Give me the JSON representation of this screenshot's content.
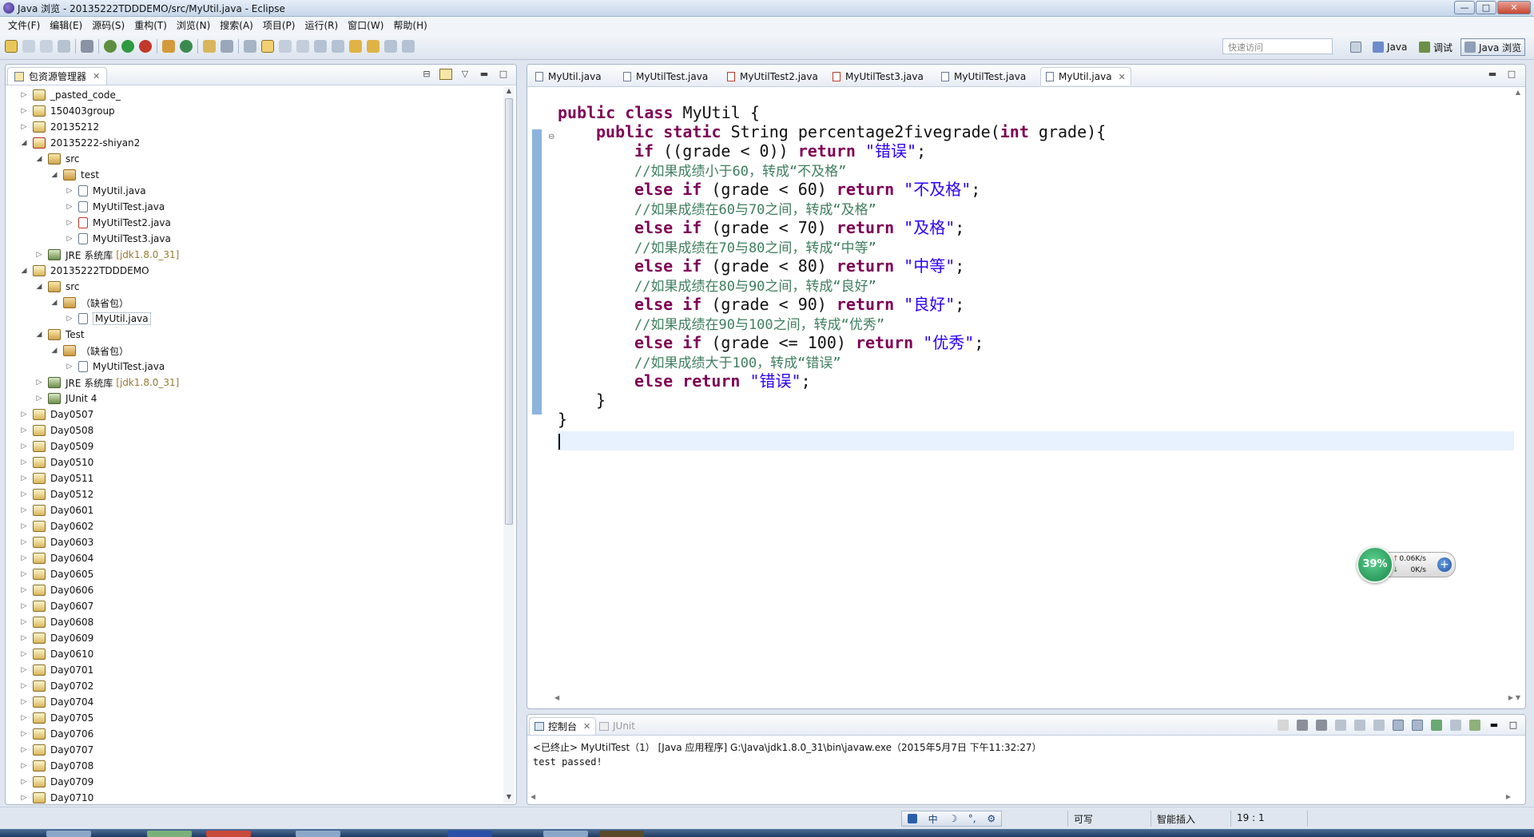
{
  "window": {
    "title": "Java 浏览 - 20135222TDDDEMO/src/MyUtil.java - Eclipse",
    "controls": [
      "—",
      "□",
      "✕"
    ]
  },
  "menu": [
    "文件(F)",
    "编辑(E)",
    "源码(S)",
    "重构(T)",
    "浏览(N)",
    "搜索(A)",
    "项目(P)",
    "运行(R)",
    "窗口(W)",
    "帮助(H)"
  ],
  "toolbar": {
    "quick_access_placeholder": "快速访问",
    "perspectives": [
      "Java",
      "调试",
      "Java 浏览"
    ],
    "active_perspective": "Java 浏览"
  },
  "package_explorer": {
    "title": "包资源管理器",
    "items": [
      {
        "label": "_pasted_code_",
        "depth": 0,
        "twisty": "▷",
        "icon": "project"
      },
      {
        "label": "150403group",
        "depth": 0,
        "twisty": "▷",
        "icon": "project"
      },
      {
        "label": "20135212",
        "depth": 0,
        "twisty": "▷",
        "icon": "project"
      },
      {
        "label": "20135222-shiyan2",
        "depth": 0,
        "twisty": "◢",
        "icon": "project-err"
      },
      {
        "label": "src",
        "depth": 1,
        "twisty": "◢",
        "icon": "src"
      },
      {
        "label": "test",
        "depth": 2,
        "twisty": "◢",
        "icon": "pkg"
      },
      {
        "label": "MyUtil.java",
        "depth": 3,
        "twisty": "▷",
        "icon": "java"
      },
      {
        "label": "MyUtilTest.java",
        "depth": 3,
        "twisty": "▷",
        "icon": "java"
      },
      {
        "label": "MyUtilTest2.java",
        "depth": 3,
        "twisty": "▷",
        "icon": "java-err"
      },
      {
        "label": "MyUtilTest3.java",
        "depth": 3,
        "twisty": "▷",
        "icon": "java"
      },
      {
        "label": "JRE 系统库",
        "suffix": "[jdk1.8.0_31]",
        "depth": 1,
        "twisty": "▷",
        "icon": "lib"
      },
      {
        "label": "20135222TDDDEMO",
        "depth": 0,
        "twisty": "◢",
        "icon": "project"
      },
      {
        "label": "src",
        "depth": 1,
        "twisty": "◢",
        "icon": "src"
      },
      {
        "label": "（缺省包）",
        "depth": 2,
        "twisty": "◢",
        "icon": "pkg"
      },
      {
        "label": "MyUtil.java",
        "depth": 3,
        "twisty": "▷",
        "icon": "java",
        "selected": true
      },
      {
        "label": "Test",
        "depth": 1,
        "twisty": "◢",
        "icon": "src"
      },
      {
        "label": "（缺省包）",
        "depth": 2,
        "twisty": "◢",
        "icon": "pkg"
      },
      {
        "label": "MyUtilTest.java",
        "depth": 3,
        "twisty": "▷",
        "icon": "java"
      },
      {
        "label": "JRE 系统库",
        "suffix": "[jdk1.8.0_31]",
        "depth": 1,
        "twisty": "▷",
        "icon": "lib"
      },
      {
        "label": "JUnit 4",
        "depth": 1,
        "twisty": "▷",
        "icon": "lib"
      },
      {
        "label": "Day0507",
        "depth": 0,
        "twisty": "▷",
        "icon": "project"
      },
      {
        "label": "Day0508",
        "depth": 0,
        "twisty": "▷",
        "icon": "project"
      },
      {
        "label": "Day0509",
        "depth": 0,
        "twisty": "▷",
        "icon": "project"
      },
      {
        "label": "Day0510",
        "depth": 0,
        "twisty": "▷",
        "icon": "project"
      },
      {
        "label": "Day0511",
        "depth": 0,
        "twisty": "▷",
        "icon": "project"
      },
      {
        "label": "Day0512",
        "depth": 0,
        "twisty": "▷",
        "icon": "project"
      },
      {
        "label": "Day0601",
        "depth": 0,
        "twisty": "▷",
        "icon": "project"
      },
      {
        "label": "Day0602",
        "depth": 0,
        "twisty": "▷",
        "icon": "project"
      },
      {
        "label": "Day0603",
        "depth": 0,
        "twisty": "▷",
        "icon": "project"
      },
      {
        "label": "Day0604",
        "depth": 0,
        "twisty": "▷",
        "icon": "project"
      },
      {
        "label": "Day0605",
        "depth": 0,
        "twisty": "▷",
        "icon": "project"
      },
      {
        "label": "Day0606",
        "depth": 0,
        "twisty": "▷",
        "icon": "project"
      },
      {
        "label": "Day0607",
        "depth": 0,
        "twisty": "▷",
        "icon": "project"
      },
      {
        "label": "Day0608",
        "depth": 0,
        "twisty": "▷",
        "icon": "project"
      },
      {
        "label": "Day0609",
        "depth": 0,
        "twisty": "▷",
        "icon": "project"
      },
      {
        "label": "Day0610",
        "depth": 0,
        "twisty": "▷",
        "icon": "project"
      },
      {
        "label": "Day0701",
        "depth": 0,
        "twisty": "▷",
        "icon": "project"
      },
      {
        "label": "Day0702",
        "depth": 0,
        "twisty": "▷",
        "icon": "project"
      },
      {
        "label": "Day0704",
        "depth": 0,
        "twisty": "▷",
        "icon": "project"
      },
      {
        "label": "Day0705",
        "depth": 0,
        "twisty": "▷",
        "icon": "project"
      },
      {
        "label": "Day0706",
        "depth": 0,
        "twisty": "▷",
        "icon": "project"
      },
      {
        "label": "Day0707",
        "depth": 0,
        "twisty": "▷",
        "icon": "project"
      },
      {
        "label": "Day0708",
        "depth": 0,
        "twisty": "▷",
        "icon": "project"
      },
      {
        "label": "Day0709",
        "depth": 0,
        "twisty": "▷",
        "icon": "project"
      },
      {
        "label": "Day0710",
        "depth": 0,
        "twisty": "▷",
        "icon": "project"
      }
    ]
  },
  "editor": {
    "tabs": [
      {
        "label": "MyUtil.java",
        "active": false,
        "error": false
      },
      {
        "label": "MyUtilTest.java",
        "active": false,
        "error": false
      },
      {
        "label": "MyUtilTest2.java",
        "active": false,
        "error": true
      },
      {
        "label": "MyUtilTest3.java",
        "active": false,
        "error": true
      },
      {
        "label": "MyUtilTest.java",
        "active": false,
        "error": false
      },
      {
        "label": "MyUtil.java",
        "active": true,
        "error": false
      }
    ],
    "close_glyph": "✕",
    "code_lines": [
      {
        "indent": 0,
        "segs": [
          {
            "t": "kw",
            "v": "public class"
          },
          {
            "t": "",
            "v": " MyUtil {"
          }
        ]
      },
      {
        "indent": 1,
        "segs": [
          {
            "t": "kw",
            "v": "public static"
          },
          {
            "t": "",
            "v": " String percentage2fivegrade("
          },
          {
            "t": "kw",
            "v": "int"
          },
          {
            "t": "",
            "v": " grade){"
          }
        ]
      },
      {
        "indent": 2,
        "segs": [
          {
            "t": "kw",
            "v": "if"
          },
          {
            "t": "",
            "v": " ((grade < 0)) "
          },
          {
            "t": "kw",
            "v": "return"
          },
          {
            "t": "",
            "v": " "
          },
          {
            "t": "str",
            "v": "\"错误\""
          },
          {
            "t": "",
            "v": ";"
          }
        ]
      },
      {
        "indent": 2,
        "segs": [
          {
            "t": "cm",
            "v": "//如果成绩小于60，转成“不及格”"
          }
        ]
      },
      {
        "indent": 2,
        "segs": [
          {
            "t": "kw",
            "v": "else if"
          },
          {
            "t": "",
            "v": " (grade < 60) "
          },
          {
            "t": "kw",
            "v": "return"
          },
          {
            "t": "",
            "v": " "
          },
          {
            "t": "str",
            "v": "\"不及格\""
          },
          {
            "t": "",
            "v": ";"
          }
        ]
      },
      {
        "indent": 2,
        "segs": [
          {
            "t": "cm",
            "v": "//如果成绩在60与70之间，转成“及格”"
          }
        ]
      },
      {
        "indent": 2,
        "segs": [
          {
            "t": "kw",
            "v": "else if"
          },
          {
            "t": "",
            "v": " (grade < 70) "
          },
          {
            "t": "kw",
            "v": "return"
          },
          {
            "t": "",
            "v": " "
          },
          {
            "t": "str",
            "v": "\"及格\""
          },
          {
            "t": "",
            "v": ";"
          }
        ]
      },
      {
        "indent": 2,
        "segs": [
          {
            "t": "cm",
            "v": "//如果成绩在70与80之间，转成“中等”"
          }
        ]
      },
      {
        "indent": 2,
        "segs": [
          {
            "t": "kw",
            "v": "else if"
          },
          {
            "t": "",
            "v": " (grade < 80) "
          },
          {
            "t": "kw",
            "v": "return"
          },
          {
            "t": "",
            "v": " "
          },
          {
            "t": "str",
            "v": "\"中等\""
          },
          {
            "t": "",
            "v": ";"
          }
        ]
      },
      {
        "indent": 2,
        "segs": [
          {
            "t": "cm",
            "v": "//如果成绩在80与90之间，转成“良好”"
          }
        ]
      },
      {
        "indent": 2,
        "segs": [
          {
            "t": "kw",
            "v": "else if"
          },
          {
            "t": "",
            "v": " (grade < 90) "
          },
          {
            "t": "kw",
            "v": "return"
          },
          {
            "t": "",
            "v": " "
          },
          {
            "t": "str",
            "v": "\"良好\""
          },
          {
            "t": "",
            "v": ";"
          }
        ]
      },
      {
        "indent": 2,
        "segs": [
          {
            "t": "cm",
            "v": "//如果成绩在90与100之间，转成“优秀”"
          }
        ]
      },
      {
        "indent": 2,
        "segs": [
          {
            "t": "kw",
            "v": "else if"
          },
          {
            "t": "",
            "v": " (grade <= 100) "
          },
          {
            "t": "kw",
            "v": "return"
          },
          {
            "t": "",
            "v": " "
          },
          {
            "t": "str",
            "v": "\"优秀\""
          },
          {
            "t": "",
            "v": ";"
          }
        ]
      },
      {
        "indent": 2,
        "segs": [
          {
            "t": "cm",
            "v": "//如果成绩大于100，转成“错误”"
          }
        ]
      },
      {
        "indent": 2,
        "segs": [
          {
            "t": "kw",
            "v": "else return"
          },
          {
            "t": "",
            "v": " "
          },
          {
            "t": "str",
            "v": "\"错误\""
          },
          {
            "t": "",
            "v": ";"
          }
        ]
      },
      {
        "indent": 1,
        "segs": [
          {
            "t": "",
            "v": "}"
          }
        ]
      },
      {
        "indent": 0,
        "segs": [
          {
            "t": "",
            "v": "}"
          }
        ]
      }
    ]
  },
  "net_widget": {
    "cpu": "39%",
    "up": "0.06K/s",
    "down": "0K/s",
    "plus": "+"
  },
  "console": {
    "tab_label": "控制台",
    "junit_label": "JUnit",
    "status": "<已终止> MyUtilTest（1） [Java 应用程序] G:\\Java\\jdk1.8.0_31\\bin\\javaw.exe（2015年5月7日 下午11:32:27）",
    "output": "test passed!"
  },
  "statusbar": {
    "ime": [
      "中",
      "☽",
      "°,",
      "⚙"
    ],
    "writable": "可写",
    "insert_mode": "智能插入",
    "position": "19 : 1"
  },
  "colors": {
    "keyword": "#7f0055",
    "string": "#2a00ff",
    "comment": "#3f7f5f"
  }
}
